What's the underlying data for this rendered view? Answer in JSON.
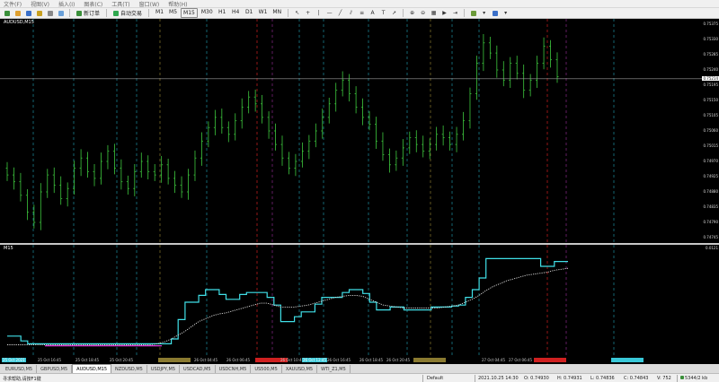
{
  "menu": [
    "文件(F)",
    "视图(V)",
    "插入(I)",
    "图表(C)",
    "工具(T)",
    "窗口(W)",
    "帮助(H)"
  ],
  "toolbar": {
    "new_order_label": "新订单",
    "auto_trade_label": "自动交易",
    "timeframes": [
      "M1",
      "M5",
      "M15",
      "M30",
      "H1",
      "H4",
      "D1",
      "W1",
      "MN"
    ]
  },
  "chart": {
    "title": "AUDUSD,M15",
    "subwindow_title": "M15",
    "current_price": "0.75214",
    "sub_axis_top": "0.0121"
  },
  "chart_data": {
    "type": "candlestick",
    "symbol": "AUDUSD",
    "timeframe": "M15",
    "price_ticks": [
      "0.75375",
      "0.75330",
      "0.75285",
      "0.75240",
      "0.75195",
      "0.75150",
      "0.75105",
      "0.75060",
      "0.75015",
      "0.74970",
      "0.74925",
      "0.74880",
      "0.74835",
      "0.74790",
      "0.74745"
    ],
    "ylim": [
      0.74745,
      0.75375
    ],
    "closes": [
      0.7493,
      0.7491,
      0.7487,
      0.7482,
      0.7479,
      0.7488,
      0.7493,
      0.749,
      0.7486,
      0.7489,
      0.7495,
      0.7498,
      0.7494,
      0.7492,
      0.7497,
      0.75,
      0.7495,
      0.7491,
      0.7489,
      0.7494,
      0.7497,
      0.7494,
      0.7493,
      0.7496,
      0.7492,
      0.749,
      0.7488,
      0.7493,
      0.7498,
      0.7503,
      0.7507,
      0.751,
      0.7507,
      0.7505,
      0.7509,
      0.7513,
      0.7516,
      0.7514,
      0.751,
      0.7506,
      0.7502,
      0.7498,
      0.7495,
      0.7497,
      0.75,
      0.7503,
      0.7506,
      0.751,
      0.7514,
      0.7518,
      0.7521,
      0.7517,
      0.7513,
      0.751,
      0.7508,
      0.7503,
      0.7499,
      0.7496,
      0.7498,
      0.7501,
      0.7504,
      0.7502,
      0.75,
      0.7502,
      0.7505,
      0.7504,
      0.7502,
      0.7505,
      0.7509,
      0.7517,
      0.7526,
      0.7532,
      0.7529,
      0.7524,
      0.7521,
      0.7526,
      0.7523,
      0.7518,
      0.7521,
      0.7526,
      0.7531,
      0.7527,
      0.7522
    ],
    "indicator_series": [
      {
        "name": "",
        "color": "#40e0e8",
        "values": [
          0.15,
          0.15,
          0.1,
          0.07,
          0.07,
          0.07,
          0.07,
          0.07,
          0.07,
          0.07,
          0.07,
          0.07,
          0.07,
          0.07,
          0.07,
          0.07,
          0.07,
          0.07,
          0.07,
          0.07,
          0.07,
          0.07,
          0.07,
          0.07,
          0.12,
          0.32,
          0.5,
          0.5,
          0.57,
          0.63,
          0.63,
          0.58,
          0.53,
          0.53,
          0.58,
          0.6,
          0.6,
          0.6,
          0.55,
          0.47,
          0.3,
          0.3,
          0.35,
          0.4,
          0.4,
          0.48,
          0.55,
          0.55,
          0.55,
          0.6,
          0.63,
          0.63,
          0.59,
          0.5,
          0.42,
          0.42,
          0.45,
          0.45,
          0.42,
          0.42,
          0.42,
          0.42,
          0.45,
          0.45,
          0.45,
          0.46,
          0.47,
          0.55,
          0.63,
          0.75,
          0.95,
          0.95,
          0.95,
          0.95,
          0.95,
          0.95,
          0.95,
          0.95,
          0.87,
          0.87,
          0.92,
          0.92,
          0.92
        ]
      },
      {
        "name": "",
        "color": "#e040e0",
        "values": [
          0.05,
          0.05,
          0.05,
          0.05,
          0.05,
          0.05,
          0.05,
          0.05
        ]
      },
      {
        "name": "",
        "color": "#dddddd",
        "values": [
          0.06,
          0.06,
          0.06,
          0.06,
          0.06,
          0.06,
          0.06,
          0.06,
          0.06,
          0.06,
          0.06,
          0.06,
          0.06,
          0.06,
          0.06,
          0.06,
          0.06,
          0.06,
          0.06,
          0.06,
          0.06,
          0.06,
          0.07,
          0.09,
          0.12,
          0.16,
          0.2,
          0.25,
          0.3,
          0.33,
          0.36,
          0.38,
          0.39,
          0.41,
          0.43,
          0.45,
          0.47,
          0.49,
          0.49,
          0.47,
          0.45,
          0.45,
          0.45,
          0.46,
          0.47,
          0.49,
          0.51,
          0.53,
          0.55,
          0.56,
          0.57,
          0.57,
          0.56,
          0.53,
          0.5,
          0.47,
          0.46,
          0.45,
          0.44,
          0.44,
          0.44,
          0.44,
          0.44,
          0.44,
          0.45,
          0.46,
          0.47,
          0.5,
          0.53,
          0.57,
          0.62,
          0.66,
          0.69,
          0.72,
          0.74,
          0.76,
          0.78,
          0.79,
          0.8,
          0.81,
          0.83,
          0.84,
          0.85
        ]
      }
    ]
  },
  "time_labels": [
    {
      "text": "25 Oct 2021",
      "hl": "#39c8d8"
    },
    {
      "text": "25 Oct 16:45",
      "hl": ""
    },
    {
      "text": "25 Oct 18:45",
      "hl": ""
    },
    {
      "text": "25 Oct 20:45",
      "hl": ""
    },
    {
      "text": "",
      "hl": "#8a7a30"
    },
    {
      "text": "26 Oct 04:45",
      "hl": ""
    },
    {
      "text": "26 Oct 06:45",
      "hl": ""
    },
    {
      "text": "",
      "hl": "#d02020"
    },
    {
      "text": "26 Oct 10:45",
      "hl": ""
    },
    {
      "text": "26 Oct 12:45",
      "hl": "#39c8d8"
    },
    {
      "text": "26 Oct 16:45",
      "hl": ""
    },
    {
      "text": "26 Oct 18:45",
      "hl": ""
    },
    {
      "text": "26 Oct 20:45",
      "hl": ""
    },
    {
      "text": "",
      "hl": "#8a7a30"
    },
    {
      "text": "27 Oct 04:45",
      "hl": ""
    },
    {
      "text": "27 Oct 06:45",
      "hl": ""
    },
    {
      "text": "",
      "hl": "#d02020"
    },
    {
      "text": "",
      "hl": "#39c8d8"
    }
  ],
  "tabs": [
    "EURUSD,M5",
    "GBPUSD,M5",
    "AUDUSD,M15",
    "NZDUSD,M5",
    "USDJPY,M5",
    "USDCAD,M5",
    "USDCNH,M5",
    "US500,M5",
    "XAUUSD,M5",
    "WTI_Z1,M5"
  ],
  "active_tab_index": 2,
  "status": {
    "help": "寻求帮助,请按F1键",
    "profile": "Default",
    "datetime": "2021.10.25 14:30",
    "open": "O: 0.74930",
    "high": "H: 0.74931",
    "low": "L: 0.74836",
    "close": "C: 0.74843",
    "volume": "V: 752",
    "traffic": "5344/2 kb"
  }
}
